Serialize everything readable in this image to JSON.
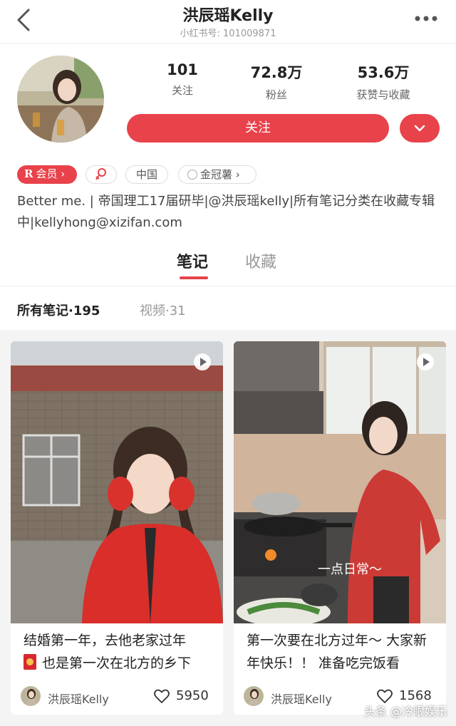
{
  "header": {
    "title": "洪辰瑶Kelly",
    "subtitle": "小红书号: 101009871",
    "back_icon": "chevron-left-icon",
    "more_icon": "more-horizontal-icon"
  },
  "profile": {
    "stats": [
      {
        "value": "101",
        "label": "关注"
      },
      {
        "value": "72.8万",
        "label": "粉丝"
      },
      {
        "value": "53.6万",
        "label": "获赞与收藏"
      }
    ],
    "follow_label": "关注",
    "dropdown_icon": "chevron-down-icon",
    "tags": {
      "member": "会员",
      "member_badge": "R",
      "region": "中国",
      "level": "金冠薯"
    },
    "bio": "Better me. | 帝国理工17届研毕|@洪辰瑶kelly|所有笔记分类在收藏专辑中|kellyhong@xizifan.com"
  },
  "tabs": [
    {
      "label": "笔记",
      "active": true
    },
    {
      "label": "收藏",
      "active": false
    }
  ],
  "filter": {
    "all_label": "所有笔记·195",
    "video_label": "视频·31"
  },
  "cards": [
    {
      "title": "结婚第一年，去他老家过年 也是第一次在北方的乡下",
      "author": "洪辰瑶Kelly",
      "likes": "5950"
    },
    {
      "title": "第一次要在北方过年～ 大家新年快乐！！ 准备吃完饭看",
      "author": "洪辰瑶Kelly",
      "likes": "1568",
      "overlay_caption": "一点日常～"
    }
  ],
  "watermark": "头条 @冷眼娱乐",
  "colors": {
    "accent": "#e8424b",
    "background": "#f4f4f4"
  }
}
